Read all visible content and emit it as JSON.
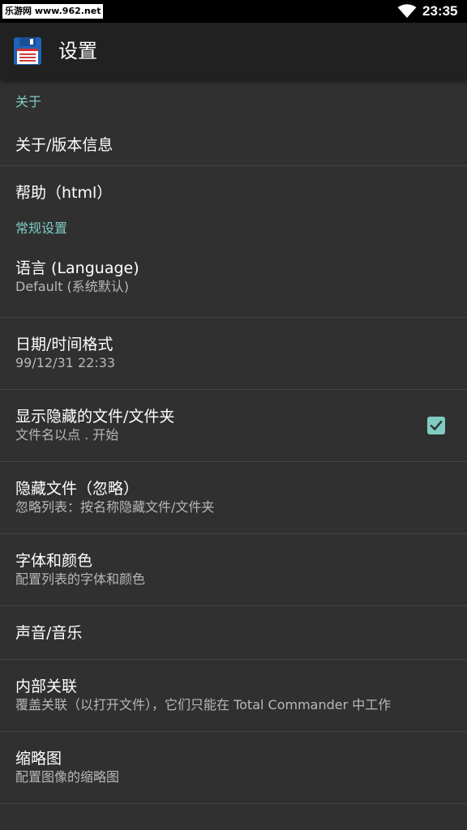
{
  "status_bar": {
    "watermark": "乐游网 www.962.net",
    "time": "23:35"
  },
  "toolbar": {
    "title": "设置",
    "icon": "floppy-disk-icon"
  },
  "sections": {
    "about": {
      "header": "关于",
      "about_version": {
        "title": "关于/版本信息"
      },
      "help": {
        "title": "帮助（html）"
      }
    },
    "general": {
      "header": "常规设置",
      "language": {
        "title": "语言 (Language)",
        "summary": "Default (系统默认)"
      },
      "date_format": {
        "title": "日期/时间格式",
        "summary": "99/12/31  22:33"
      },
      "show_hidden": {
        "title": "显示隐藏的文件/文件夹",
        "summary": "文件名以点 . 开始",
        "checked": true
      },
      "hide_files": {
        "title": "隐藏文件（忽略）",
        "summary": "忽略列表：按名称隐藏文件/文件夹"
      },
      "fonts_colors": {
        "title": "字体和颜色",
        "summary": "配置列表的字体和颜色"
      },
      "sound_music": {
        "title": "声音/音乐"
      },
      "internal_assoc": {
        "title": "内部关联",
        "summary": "覆盖关联（以打开文件），它们只能在 Total Commander 中工作"
      },
      "thumbnails": {
        "title": "缩略图",
        "summary": "配置图像的缩略图"
      }
    }
  },
  "colors": {
    "accent": "#80cbc4",
    "background": "#303030",
    "toolbar": "#212121"
  }
}
